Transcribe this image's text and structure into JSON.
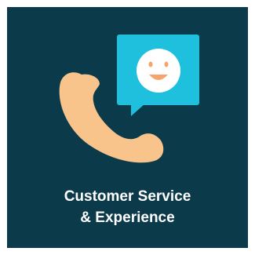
{
  "tile": {
    "background_color": "#0b3a4a",
    "icons": [
      "phone-handset-icon",
      "speech-bubble-icon",
      "smiley-face-icon"
    ],
    "colors": {
      "handset": "#f9c48c",
      "bubble": "#1ec0dd",
      "face": "#ffffff",
      "face_features": "#f5a46a"
    },
    "title_line_1": "Customer Service",
    "title_line_2": "& Experience"
  }
}
